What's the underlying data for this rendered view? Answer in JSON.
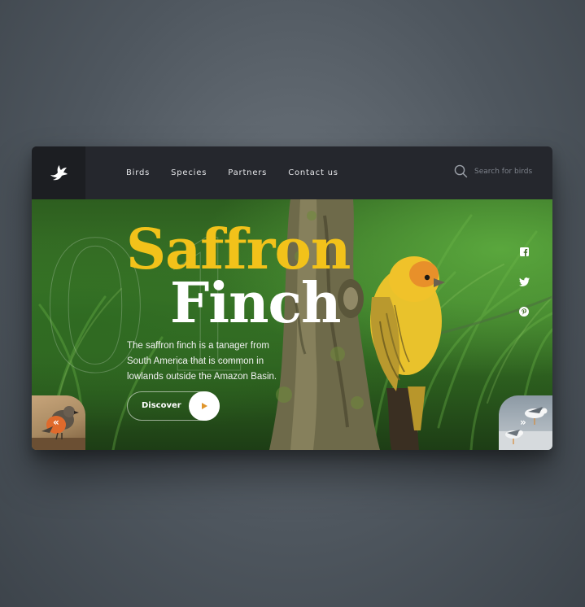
{
  "nav": {
    "links": [
      "Birds",
      "Species",
      "Partners",
      "Contact us"
    ],
    "search_placeholder": "Search for birds"
  },
  "hero": {
    "title_line1": "Saffron",
    "title_line2": "Finch",
    "description": "The saffron finch is a tanager from South America that is common in lowlands outside the Amazon Basin.",
    "cta_label": "Discover",
    "background_number": "01",
    "prev_arrow": "«",
    "next_arrow": "»"
  },
  "icons": {
    "logo": "bird-logo-icon",
    "search": "search-icon",
    "play": "play-icon",
    "social": [
      "facebook-icon",
      "twitter-icon",
      "pinterest-icon"
    ]
  },
  "colors": {
    "accent_yellow": "#f2c21a",
    "nav_bg": "#25272d",
    "logo_bg": "#1c1e22",
    "play_triangle": "#e0952b"
  }
}
